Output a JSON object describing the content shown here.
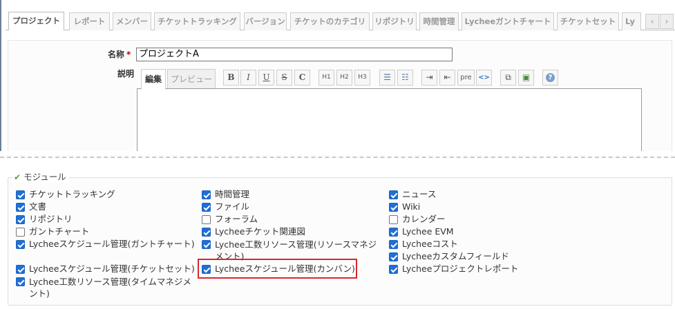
{
  "tabs": [
    {
      "label": "プロジェクト",
      "selected": true
    },
    {
      "label": "レポート",
      "selected": false
    },
    {
      "label": "メンバー",
      "selected": false
    },
    {
      "label": "チケットトラッキング",
      "selected": false
    },
    {
      "label": "バージョン",
      "selected": false
    },
    {
      "label": "チケットのカテゴリ",
      "selected": false
    },
    {
      "label": "リポジトリ",
      "selected": false
    },
    {
      "label": "時間管理",
      "selected": false
    },
    {
      "label": "Lycheeガントチャート",
      "selected": false
    },
    {
      "label": "チケットセット",
      "selected": false
    },
    {
      "label": "Ly",
      "selected": false
    }
  ],
  "tab_scroll": {
    "left_icon": "chevron-left-icon",
    "right_icon": "chevron-right-icon",
    "left": "‹",
    "right": "›"
  },
  "form": {
    "name_label": "名称",
    "required_mark": "*",
    "name_value": "プロジェクトA",
    "description_label": "説明",
    "editor_tabs": {
      "edit": "編集",
      "preview": "プレビュー"
    },
    "toolbar": {
      "bold": "B",
      "italic": "I",
      "underline": "U",
      "strike": "S",
      "code": "C",
      "h1": "H1",
      "h2": "H2",
      "h3": "H3",
      "ul": "☰",
      "ol": "☷",
      "indent_right": "⇥",
      "indent_left": "⇤",
      "pre": "pre",
      "inline_code": "<>",
      "link": "⧉",
      "image": "▣",
      "help": "?"
    }
  },
  "modules": {
    "legend": "モジュール",
    "legend_icon": "checkmark-icon",
    "columns": [
      [
        {
          "label": "チケットトラッキング",
          "checked": true
        },
        {
          "label": "文書",
          "checked": true
        },
        {
          "label": "リポジトリ",
          "checked": true
        },
        {
          "label": "ガントチャート",
          "checked": false
        },
        {
          "label": "Lycheeスケジュール管理(ガントチャート)",
          "checked": true
        },
        {
          "label": "Lycheeスケジュール管理(チケットセット)",
          "checked": true
        },
        {
          "label": "Lychee工数リソース管理(タイムマネジメント)",
          "checked": true
        }
      ],
      [
        {
          "label": "時間管理",
          "checked": true
        },
        {
          "label": "ファイル",
          "checked": true
        },
        {
          "label": "フォーラム",
          "checked": false
        },
        {
          "label": "Lycheeチケット関連図",
          "checked": true
        },
        {
          "label": "Lychee工数リソース管理(リソースマネジメント)",
          "checked": true
        },
        {
          "label": "Lycheeスケジュール管理(カンバン)",
          "checked": true
        }
      ],
      [
        {
          "label": "ニュース",
          "checked": true
        },
        {
          "label": "Wiki",
          "checked": true
        },
        {
          "label": "カレンダー",
          "checked": false
        },
        {
          "label": "Lychee EVM",
          "checked": true
        },
        {
          "label": "Lycheeコスト",
          "checked": true
        },
        {
          "label": "Lycheeカスタムフィールド",
          "checked": true
        },
        {
          "label": "Lycheeプロジェクトレポート",
          "checked": true
        }
      ]
    ]
  },
  "colors": {
    "checkbox": "#1f6fd6",
    "highlight": "#d9272e",
    "required": "#bb0000"
  }
}
